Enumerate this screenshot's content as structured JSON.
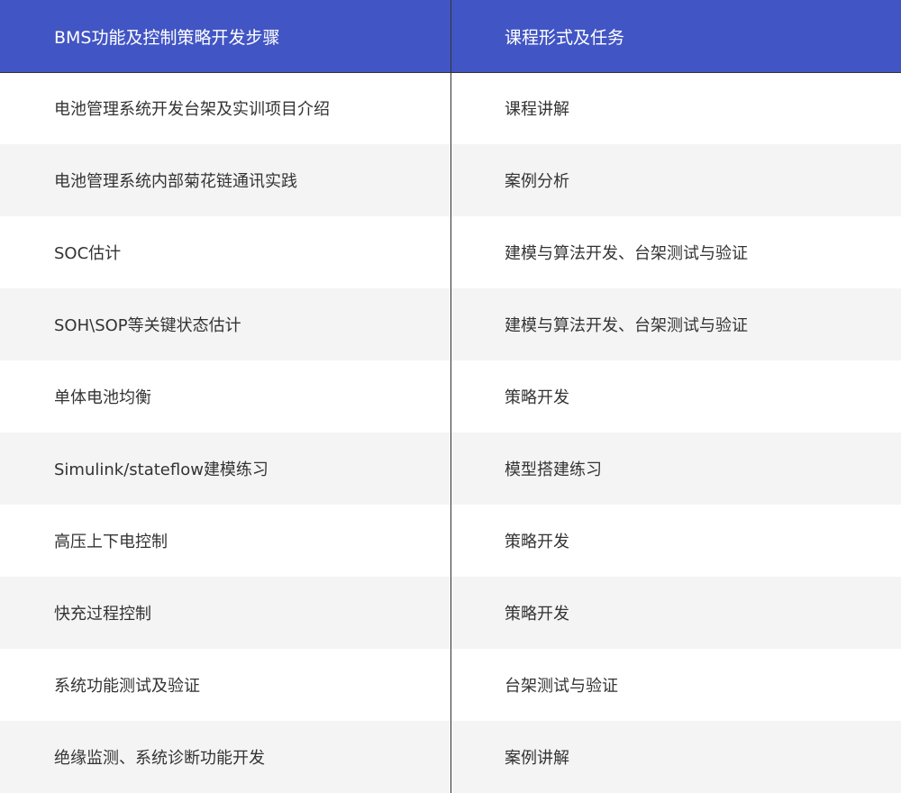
{
  "header": {
    "col1": "BMS功能及控制策略开发步骤",
    "col2": "课程形式及任务"
  },
  "rows": [
    {
      "step": "电池管理系统开发台架及实训项目介绍",
      "form": "课程讲解"
    },
    {
      "step": "电池管理系统内部菊花链通讯实践",
      "form": "案例分析"
    },
    {
      "step": "SOC估计",
      "form": "建模与算法开发、台架测试与验证"
    },
    {
      "step": "SOH\\SOP等关键状态估计",
      "form": "建模与算法开发、台架测试与验证"
    },
    {
      "step": "单体电池均衡",
      "form": "策略开发"
    },
    {
      "step": "Simulink/stateflow建模练习",
      "form": "模型搭建练习"
    },
    {
      "step": "高压上下电控制",
      "form": "策略开发"
    },
    {
      "step": "快充过程控制",
      "form": "策略开发"
    },
    {
      "step": "系统功能测试及验证",
      "form": "台架测试与验证"
    },
    {
      "step": "绝缘监测、系统诊断功能开发",
      "form": "案例讲解"
    }
  ],
  "colors": {
    "header_bg": "#4255c4",
    "header_text": "#ffffff",
    "alt_row_bg": "#f4f4f4",
    "text": "#333333"
  }
}
